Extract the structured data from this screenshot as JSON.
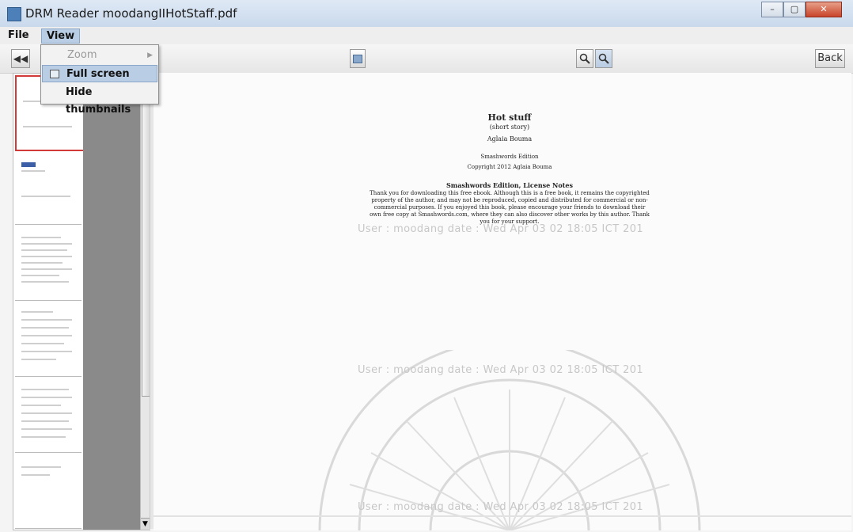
{
  "window": {
    "title": "DRM Reader moodangIIHotStaff.pdf"
  },
  "menubar": {
    "file_label": "File",
    "view_label": "View"
  },
  "view_menu": {
    "zoom_label": "Zoom",
    "full_screen_label": "Full screen",
    "hide_thumbnails_label": "Hide thumbnails"
  },
  "toolbar": {
    "prev_label": "◀◀",
    "back_label": "Back"
  },
  "document": {
    "title": "Hot stuff",
    "subtitle": "(short story)",
    "author": "Aglaia Bouma",
    "edition": "Smashwords Edition",
    "copyright": "Copyright 2012 Aglaia Bouma",
    "notes_title": "Smashwords Edition, License Notes",
    "notes_text": "Thank you for downloading this free ebook. Although this is a free book, it remains the copyrighted property of the author, and may not be reproduced, copied and distributed for commercial or non-commercial purposes. If you enjoyed this book, please encourage your friends to download their own free copy at Smashwords.com, where they can also discover other works by this author. Thank you for your support."
  },
  "watermark": {
    "text": "User : moodang date : Wed Apr 03 02 18:05 ICT 201"
  },
  "colors": {
    "selection": "#b9cde4",
    "selected_thumb_border": "#d23a3a"
  }
}
